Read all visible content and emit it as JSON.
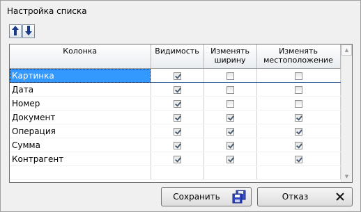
{
  "window": {
    "title": "Настройка списка"
  },
  "toolbar": {
    "move_up_icon": "arrow-up-icon",
    "move_down_icon": "arrow-down-icon"
  },
  "grid": {
    "headers": {
      "column": "Колонка",
      "visibility": "Видимость",
      "resize": "Изменять ширину",
      "reposition": "Изменять местоположение"
    },
    "rows": [
      {
        "name": "Картинка",
        "visible": true,
        "resize": false,
        "reposition": false,
        "selected": true
      },
      {
        "name": "Дата",
        "visible": true,
        "resize": false,
        "reposition": false,
        "selected": false
      },
      {
        "name": "Номер",
        "visible": true,
        "resize": false,
        "reposition": false,
        "selected": false
      },
      {
        "name": "Документ",
        "visible": true,
        "resize": true,
        "reposition": true,
        "selected": false
      },
      {
        "name": "Операция",
        "visible": true,
        "resize": true,
        "reposition": true,
        "selected": false
      },
      {
        "name": "Сумма",
        "visible": true,
        "resize": true,
        "reposition": true,
        "selected": false
      },
      {
        "name": "Контрагент",
        "visible": true,
        "resize": true,
        "reposition": true,
        "selected": false
      }
    ]
  },
  "buttons": {
    "save_label": "Сохранить",
    "save_icon": "floppy-disk-icon",
    "cancel_label": "Отказ",
    "cancel_icon": "close-icon"
  },
  "colors": {
    "selection": "#3399ff",
    "arrow": "#1a3a8a"
  }
}
